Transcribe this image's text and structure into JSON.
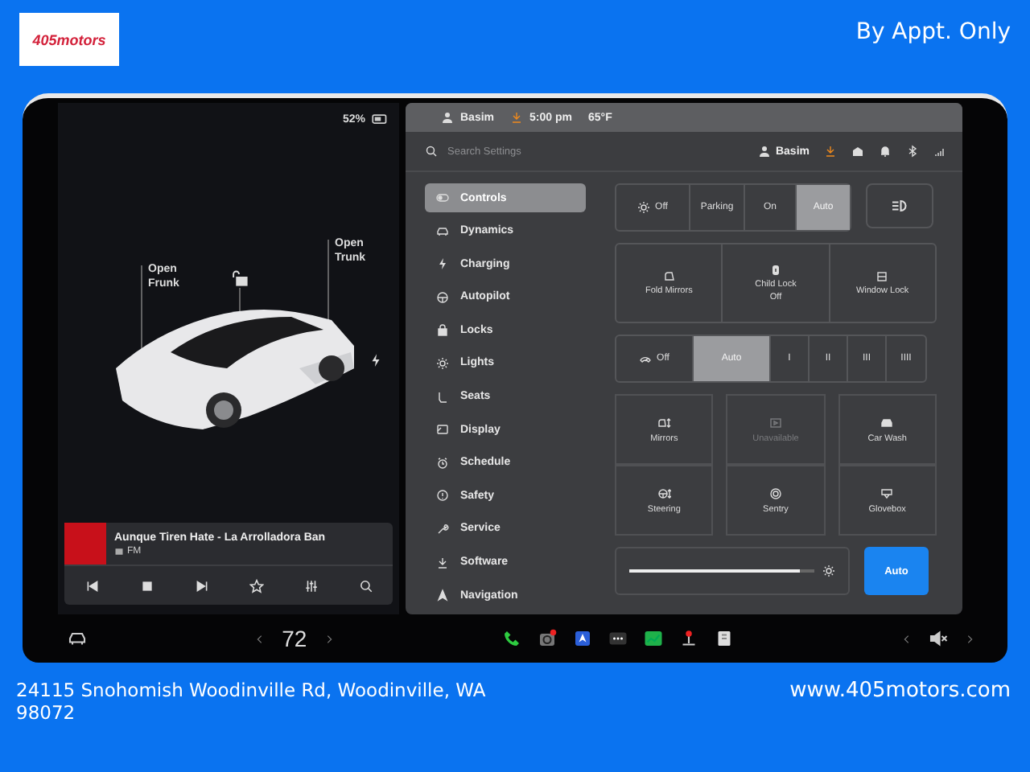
{
  "header": {
    "logo": "405motors",
    "tagline": "By Appt. Only"
  },
  "car_panel": {
    "battery": "52%",
    "frunk_label": "Open Frunk",
    "trunk_label": "Open Trunk",
    "media": {
      "title": "Aunque Tiren Hate - La Arrolladora Ban",
      "source": "FM"
    }
  },
  "map_bar": {
    "user": "Basim",
    "time": "5:00 pm",
    "temperature": "65°F"
  },
  "settings": {
    "search": {
      "placeholder": "Search Settings"
    },
    "user": "Basim",
    "menu": [
      {
        "label": "Controls",
        "selected": true
      },
      {
        "label": "Dynamics",
        "selected": false
      },
      {
        "label": "Charging",
        "selected": false
      },
      {
        "label": "Autopilot",
        "selected": false
      },
      {
        "label": "Locks",
        "selected": false
      },
      {
        "label": "Lights",
        "selected": false
      },
      {
        "label": "Seats",
        "selected": false
      },
      {
        "label": "Display",
        "selected": false
      },
      {
        "label": "Schedule",
        "selected": false
      },
      {
        "label": "Safety",
        "selected": false
      },
      {
        "label": "Service",
        "selected": false
      },
      {
        "label": "Software",
        "selected": false
      },
      {
        "label": "Navigation",
        "selected": false
      }
    ],
    "headlights": [
      {
        "label": "Off",
        "selected": false
      },
      {
        "label": "Parking",
        "selected": false
      },
      {
        "label": "On",
        "selected": false
      },
      {
        "label": "Auto",
        "selected": true
      }
    ],
    "tiles": [
      {
        "label": "Fold Mirrors"
      },
      {
        "label": "Child Lock",
        "sub": "Off"
      },
      {
        "label": "Window Lock"
      }
    ],
    "wipers": [
      {
        "label": "Off",
        "selected": false
      },
      {
        "label": "Auto",
        "selected": true
      },
      {
        "label": "I",
        "selected": false
      },
      {
        "label": "II",
        "selected": false
      },
      {
        "label": "III",
        "selected": false
      },
      {
        "label": "IIII",
        "selected": false
      }
    ],
    "quick": [
      {
        "label": "Mirrors",
        "disabled": false
      },
      {
        "label": "Unavailable",
        "disabled": true
      },
      {
        "label": "Car Wash",
        "disabled": false
      },
      {
        "label": "Steering",
        "disabled": false
      },
      {
        "label": "Sentry",
        "disabled": false
      },
      {
        "label": "Glovebox",
        "disabled": false
      }
    ],
    "brightness": {
      "level": 0.92,
      "auto": {
        "label": "Auto",
        "on": true
      }
    }
  },
  "taskbar": {
    "temperature": "72"
  },
  "footer": {
    "address": "24115 Snohomish Woodinville Rd, Woodinville, WA 98072",
    "website": "www.405motors.com"
  }
}
